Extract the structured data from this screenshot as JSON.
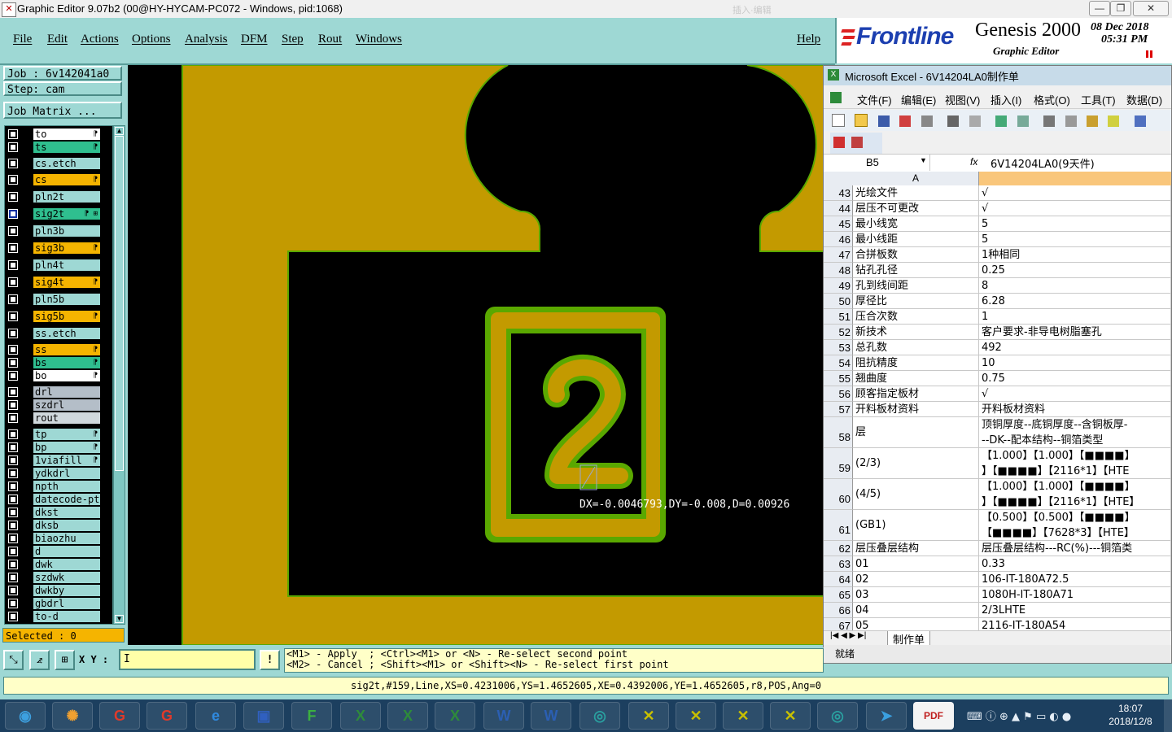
{
  "window": {
    "title": "Graphic Editor 9.07b2 (00@HY-HYCAM-PC072 - Windows, pid:1068)",
    "faint_text": "插入·编辑"
  },
  "menubar": {
    "items": [
      "File",
      "Edit",
      "Actions",
      "Options",
      "Analysis",
      "DFM",
      "Step",
      "Rout",
      "Windows"
    ],
    "help": "Help"
  },
  "logo": {
    "brand": "Frontline",
    "product": "Genesis 2000",
    "subtitle": "Graphic Editor",
    "date": "08 Dec 2018",
    "time": "05:31 PM"
  },
  "job": {
    "job_label": "Job : 6v142041a0",
    "step_label": "Step: cam",
    "matrix_button": "Job Matrix ..."
  },
  "layers": [
    {
      "name": "to",
      "color": "#ffffff",
      "flag": "⁋"
    },
    {
      "name": "ts",
      "color": "#2fbf8f",
      "flag": "⁋"
    },
    {
      "name": "cs.etch",
      "color": "#9ed8d4",
      "flag": ""
    },
    {
      "name": "cs",
      "color": "#f5b400",
      "flag": "⁋"
    },
    {
      "name": "pln2t",
      "color": "#9ed8d4",
      "flag": ""
    },
    {
      "name": "sig2t",
      "color": "#2fbf8f",
      "flag": "⁋ ⊞",
      "active": true
    },
    {
      "name": "pln3b",
      "color": "#9ed8d4",
      "flag": ""
    },
    {
      "name": "sig3b",
      "color": "#f5b400",
      "flag": "⁋"
    },
    {
      "name": "pln4t",
      "color": "#9ed8d4",
      "flag": ""
    },
    {
      "name": "sig4t",
      "color": "#f5b400",
      "flag": "⁋"
    },
    {
      "name": "pln5b",
      "color": "#9ed8d4",
      "flag": ""
    },
    {
      "name": "sig5b",
      "color": "#f5b400",
      "flag": "⁋"
    },
    {
      "name": "ss.etch",
      "color": "#9ed8d4",
      "flag": ""
    },
    {
      "name": "ss",
      "color": "#f5b400",
      "flag": "⁋"
    },
    {
      "name": "bs",
      "color": "#2fbf8f",
      "flag": "⁋"
    },
    {
      "name": "bo",
      "color": "#ffffff",
      "flag": "⁋"
    },
    {
      "name": "drl",
      "color": "#b4bec8",
      "flag": ""
    },
    {
      "name": "szdrl",
      "color": "#b4bec8",
      "flag": ""
    },
    {
      "name": "rout",
      "color": "#d0d8dc",
      "flag": ""
    },
    {
      "name": "tp",
      "color": "#9ed8d4",
      "flag": "⁋"
    },
    {
      "name": "bp",
      "color": "#9ed8d4",
      "flag": "⁋"
    },
    {
      "name": "1viafill",
      "color": "#9ed8d4",
      "flag": "⁋"
    },
    {
      "name": "ydkdrl",
      "color": "#9ed8d4",
      "flag": ""
    },
    {
      "name": "npth",
      "color": "#9ed8d4",
      "flag": ""
    },
    {
      "name": "datecode-ptc",
      "color": "#9ed8d4",
      "flag": ""
    },
    {
      "name": "dkst",
      "color": "#9ed8d4",
      "flag": ""
    },
    {
      "name": "dksb",
      "color": "#9ed8d4",
      "flag": ""
    },
    {
      "name": "biaozhu",
      "color": "#9ed8d4",
      "flag": ""
    },
    {
      "name": "d",
      "color": "#9ed8d4",
      "flag": ""
    },
    {
      "name": "dwk",
      "color": "#9ed8d4",
      "flag": ""
    },
    {
      "name": "szdwk",
      "color": "#9ed8d4",
      "flag": ""
    },
    {
      "name": "dwkby",
      "color": "#9ed8d4",
      "flag": ""
    },
    {
      "name": "gbdrl",
      "color": "#9ed8d4",
      "flag": ""
    },
    {
      "name": "to-d",
      "color": "#9ed8d4",
      "flag": ""
    }
  ],
  "selected": "Selected : 0",
  "canvas": {
    "measure_text": "DX=-0.0046793,DY=-0.008,D=0.00926",
    "glyph": "2",
    "copper_color": "#c39a00",
    "outline_color": "#5aa800"
  },
  "bottombar": {
    "xy_label": "X Y :",
    "xy_value": "I",
    "bang": "!",
    "hint_line1": "<M1> - Apply  ; <Ctrl><M1> or <N> - Re-select second point",
    "hint_line2": "<M2> - Cancel ; <Shift><M1> or <Shift><N> - Re-select first point"
  },
  "status_line": "sig2t,#159,Line,XS=0.4231006,YS=1.4652605,XE=0.4392006,YE=1.4652605,r8,POS,Ang=0",
  "excel": {
    "title": "Microsoft Excel - 6V14204LA0制作单",
    "menus": [
      "文件(F)",
      "编辑(E)",
      "视图(V)",
      "插入(I)",
      "格式(O)",
      "工具(T)",
      "数据(D)"
    ],
    "cell_ref": "B5",
    "fx": "fx",
    "formula": "6V14204LA0(9天件)",
    "col_a": "A",
    "rows": [
      {
        "n": "43",
        "a": "光绘文件",
        "b": "√"
      },
      {
        "n": "44",
        "a": "层压不可更改",
        "b": "√"
      },
      {
        "n": "45",
        "a": "最小线宽",
        "b": "5"
      },
      {
        "n": "46",
        "a": "最小线距",
        "b": "5"
      },
      {
        "n": "47",
        "a": "合拼板数",
        "b": "1种相同"
      },
      {
        "n": "48",
        "a": "钻孔孔径",
        "b": "0.25"
      },
      {
        "n": "49",
        "a": "孔到线间距",
        "b": "8"
      },
      {
        "n": "50",
        "a": "厚径比",
        "b": "6.28"
      },
      {
        "n": "51",
        "a": "压合次数",
        "b": "1"
      },
      {
        "n": "52",
        "a": "新技术",
        "b": "客户要求-非导电树脂塞孔"
      },
      {
        "n": "53",
        "a": "总孔数",
        "b": "492"
      },
      {
        "n": "54",
        "a": "阻抗精度",
        "b": "10"
      },
      {
        "n": "55",
        "a": "翘曲度",
        "b": "0.75"
      },
      {
        "n": "56",
        "a": "顾客指定板材",
        "b": "√"
      },
      {
        "n": "57",
        "a": "开料板材资料",
        "b": "开料板材资料"
      },
      {
        "n": "58",
        "a": "层",
        "b": "顶铜厚度--底铜厚度--含铜板厚-",
        "b2": "--DK--配本结构--铜箔类型",
        "tall": true
      },
      {
        "n": "59",
        "a": "(2/3)",
        "b": "【1.000】【1.000】【■■■■】",
        "b2": "】【■■■■】【2116*1】【HTE",
        "tall": true
      },
      {
        "n": "60",
        "a": "(4/5)",
        "b": "【1.000】【1.000】【■■■■】",
        "b2": "】【■■■■】【2116*1】【HTE】",
        "tall": true
      },
      {
        "n": "61",
        "a": "(GB1)",
        "b": "【0.500】【0.500】【■■■■】",
        "b2": "【■■■■】【7628*3】【HTE】",
        "tall": true
      },
      {
        "n": "62",
        "a": "层压叠层结构",
        "b": "层压叠层结构---RC(%)---铜箔类"
      },
      {
        "n": "63",
        "a": "01",
        "b": "0.33"
      },
      {
        "n": "64",
        "a": "02",
        "b": "106-IT-180A72.5"
      },
      {
        "n": "65",
        "a": "03",
        "b": "1080H-IT-180A71"
      },
      {
        "n": "66",
        "a": "04",
        "b": "2/3LHTE"
      },
      {
        "n": "67",
        "a": "05",
        "b": "2116-IT-180A54"
      }
    ],
    "sheet_tab": "制作单",
    "status": "就绪"
  },
  "taskbar": {
    "clock_time": "18:07",
    "clock_date": "2018/12/8",
    "apps": [
      {
        "name": "start-orb",
        "glyph": "◉",
        "color": "#3da0e0"
      },
      {
        "name": "shell-app",
        "glyph": "✺",
        "color": "#f0a030"
      },
      {
        "name": "genesis-app-1",
        "glyph": "G",
        "color": "#e03a2a"
      },
      {
        "name": "genesis-app-2",
        "glyph": "G",
        "color": "#e03a2a"
      },
      {
        "name": "internet-explorer",
        "glyph": "e",
        "color": "#2f8ae0"
      },
      {
        "name": "save-app",
        "glyph": "▣",
        "color": "#3060c0"
      },
      {
        "name": "frontline-app",
        "glyph": "F",
        "color": "#3cb040"
      },
      {
        "name": "excel-1",
        "glyph": "X",
        "color": "#2e8b3a"
      },
      {
        "name": "excel-2",
        "glyph": "X",
        "color": "#2e8b3a"
      },
      {
        "name": "excel-3",
        "glyph": "X",
        "color": "#2e8b3a"
      },
      {
        "name": "word-1",
        "glyph": "W",
        "color": "#2b5fb3"
      },
      {
        "name": "word-2",
        "glyph": "W",
        "color": "#2b5fb3"
      },
      {
        "name": "eye-app-1",
        "glyph": "◎",
        "color": "#2aa0a0"
      },
      {
        "name": "editor-window-1",
        "glyph": "✕",
        "color": "#c8c000"
      },
      {
        "name": "editor-window-2",
        "glyph": "✕",
        "color": "#c8c000"
      },
      {
        "name": "editor-window-3",
        "glyph": "✕",
        "color": "#c8c000"
      },
      {
        "name": "editor-window-4",
        "glyph": "✕",
        "color": "#c8c000"
      },
      {
        "name": "eye-app-2",
        "glyph": "◎",
        "color": "#2aa0a0"
      },
      {
        "name": "feiq-app",
        "glyph": "➤",
        "color": "#3aa0e0"
      },
      {
        "name": "pdf-app",
        "glyph": "PDF",
        "color": "#c02020"
      }
    ]
  }
}
